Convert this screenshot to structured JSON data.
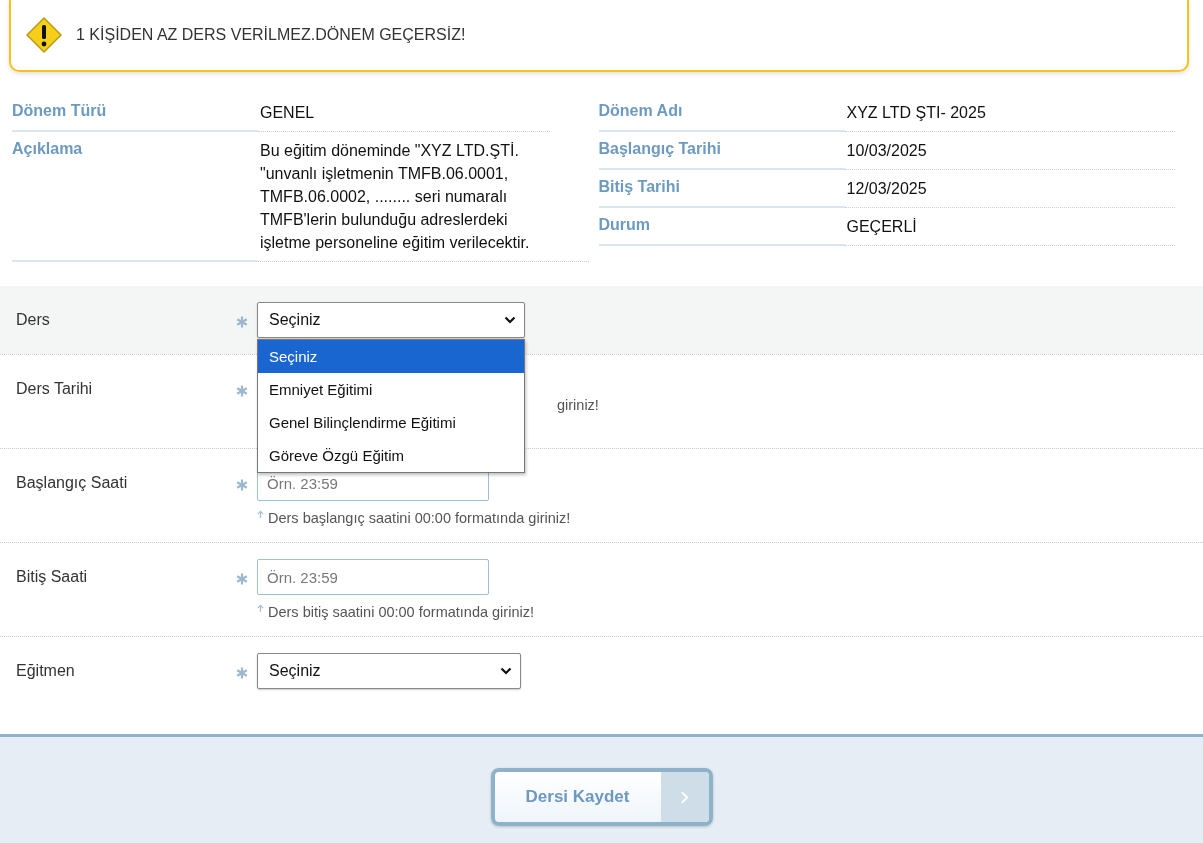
{
  "alert": {
    "message": "1 KİŞİDEN AZ DERS VERİLMEZ.DÖNEM GEÇERSİZ!"
  },
  "info_left": [
    {
      "label": "Dönem Türü",
      "value": "GENEL"
    },
    {
      "label": "Açıklama",
      "value": "Bu eğitim döneminde \"XYZ LTD.ŞTİ. \"unvanlı işletmenin TMFB.06.0001, TMFB.06.0002, ........ seri numaralı TMFB'lerin bulunduğu adreslerdeki işletme personeline eğitim verilecektir."
    }
  ],
  "info_right": [
    {
      "label": "Dönem Adı",
      "value": "XYZ LTD ŞTI- 2025"
    },
    {
      "label": "Başlangıç Tarihi",
      "value": "10/03/2025"
    },
    {
      "label": "Bitiş Tarihi",
      "value": "12/03/2025"
    },
    {
      "label": "Durum",
      "value": "GEÇERLİ"
    }
  ],
  "form": {
    "rows": [
      {
        "kind": "select",
        "label": "Ders",
        "required": true,
        "value": "Seçiniz",
        "open": true,
        "options": [
          {
            "label": "Seçiniz",
            "selected": true
          },
          {
            "label": "Emniyet Eğitimi",
            "selected": false
          },
          {
            "label": "Genel Bilinçlendirme Eğitimi",
            "selected": false
          },
          {
            "label": "Göreve Özgü Eğitim",
            "selected": false
          }
        ]
      },
      {
        "kind": "covered",
        "label": "Ders Tarihi",
        "required": true,
        "hint": "giriniz!"
      },
      {
        "kind": "input",
        "label": "Başlangıç Saati",
        "required": true,
        "placeholder": "Örn. 23:59",
        "hint": "Ders başlangıç saatini 00:00 formatında giriniz!"
      },
      {
        "kind": "input",
        "label": "Bitiş Saati",
        "required": true,
        "placeholder": "Örn. 23:59",
        "hint": "Ders bitiş saatini 00:00 formatında giriniz!"
      },
      {
        "kind": "select",
        "label": "Eğitmen",
        "required": true,
        "value": "Seçiniz",
        "open": false
      }
    ]
  },
  "submit": {
    "label": "Dersi Kaydet"
  }
}
